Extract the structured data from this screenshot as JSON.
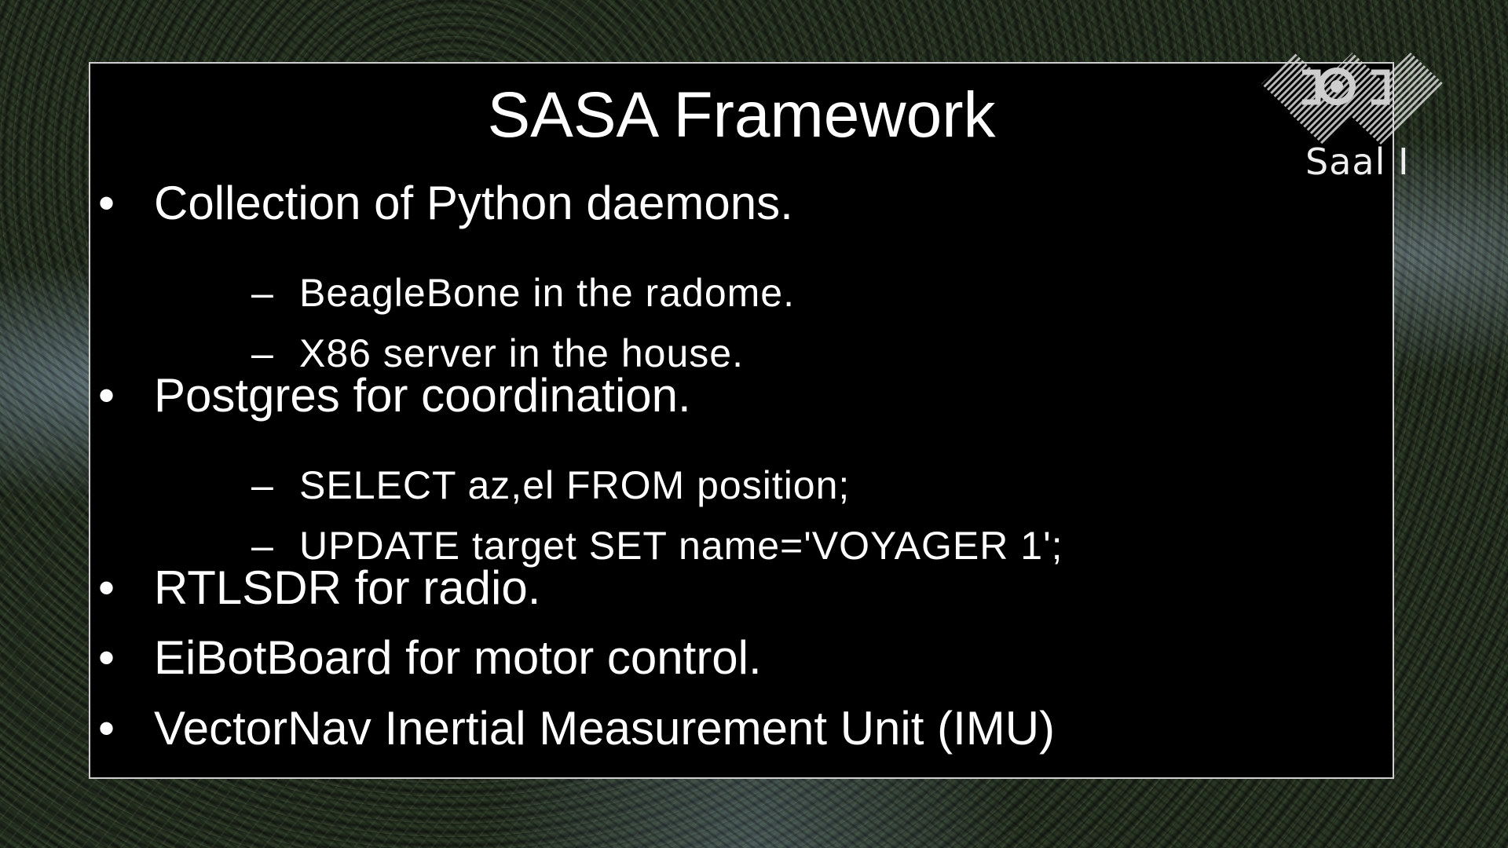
{
  "slide": {
    "title": "SASA Framework",
    "bullets": [
      {
        "marker": "•",
        "text": "Collection of Python daemons.",
        "subitems": [
          {
            "marker": "–",
            "text": "BeagleBone in the radome."
          },
          {
            "marker": "–",
            "text": "X86 server in the house."
          }
        ]
      },
      {
        "marker": "•",
        "text": "Postgres for coordination.",
        "subitems": [
          {
            "marker": "–",
            "text": "SELECT az,el FROM position;"
          },
          {
            "marker": "–",
            "text": "UPDATE target SET name='VOYAGER 1';"
          }
        ]
      },
      {
        "marker": "•",
        "text": "RTLSDR for radio.",
        "subitems": []
      },
      {
        "marker": "•",
        "text": "EiBotBoard for motor control.",
        "subitems": []
      },
      {
        "marker": "•",
        "text": "VectorNav Inertial Measurement Unit (IMU)",
        "subitems": []
      }
    ]
  },
  "overlay": {
    "logo_icon": "conference-logo-icon",
    "room_label": "Saal I"
  },
  "colors": {
    "slide_background": "#000000",
    "text": "#ffffff",
    "slide_border": "#cfcfcf"
  }
}
